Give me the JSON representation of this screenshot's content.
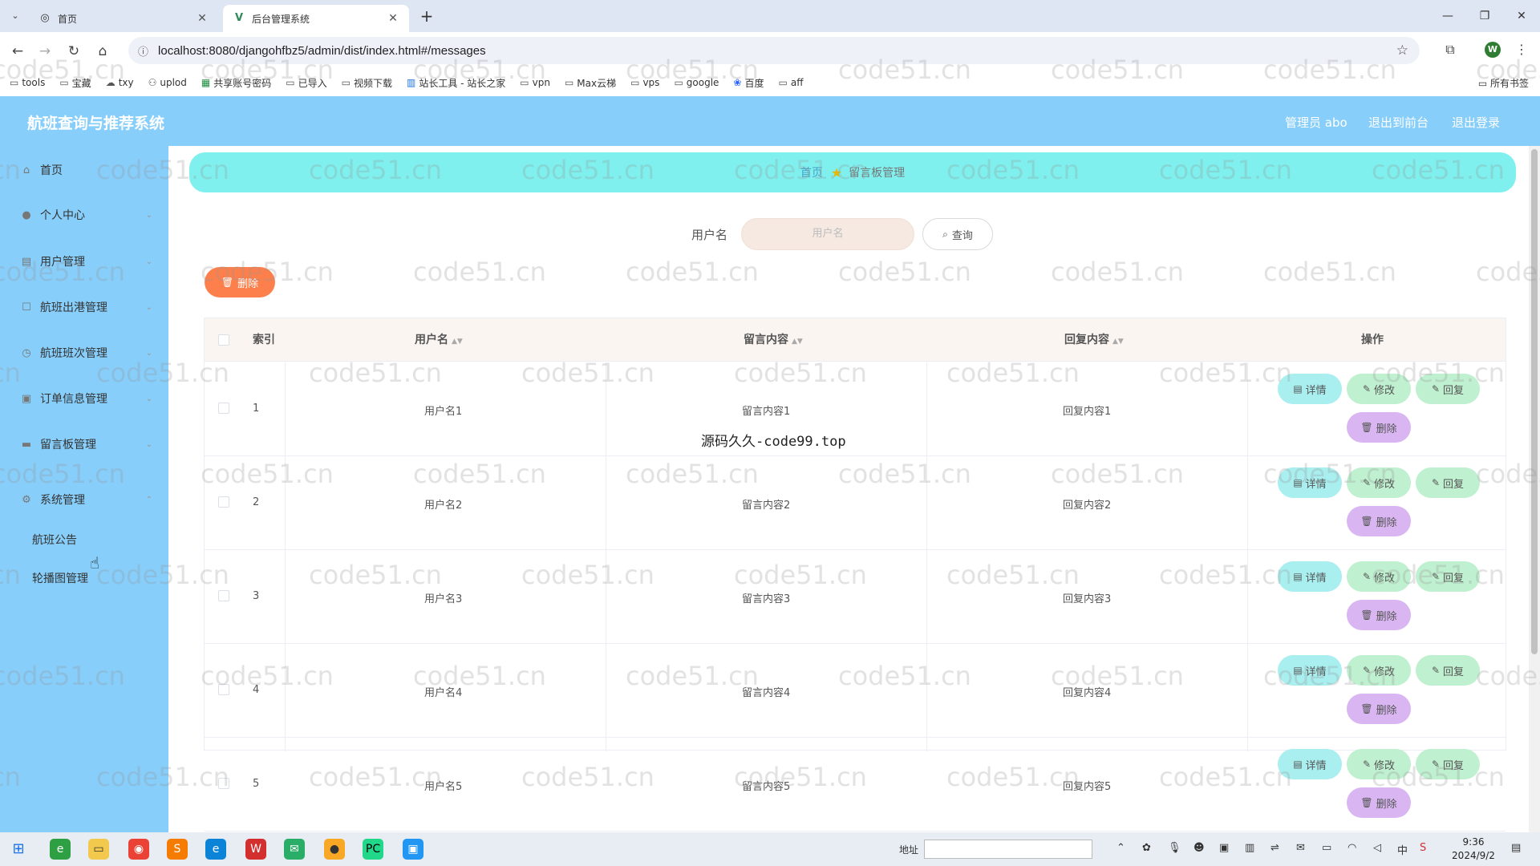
{
  "browser": {
    "tabs": [
      {
        "title": "首页",
        "active": false
      },
      {
        "title": "后台管理系统",
        "active": true
      }
    ],
    "url": "localhost:8080/djangohfbz5/admin/dist/index.html#/messages",
    "profile_initial": "W",
    "bookmarks": [
      "tools",
      "宝藏",
      "txy",
      "uplod",
      "共享账号密码",
      "已导入",
      "视频下载",
      "站长工具 - 站长之家",
      "vpn",
      "Max云梯",
      "vps",
      "google",
      "百度",
      "aff"
    ],
    "bookmarks_right": "所有书签"
  },
  "header": {
    "title": "航班查询与推荐系统",
    "user": "管理员 abo",
    "to_frontend": "退出到前台",
    "logout": "退出登录"
  },
  "sidebar": {
    "items": [
      {
        "label": "首页",
        "icon": "home-icon"
      },
      {
        "label": "个人中心",
        "icon": "user-icon"
      },
      {
        "label": "用户管理",
        "icon": "grid-icon"
      },
      {
        "label": "航班出港管理",
        "icon": "box-icon"
      },
      {
        "label": "航班班次管理",
        "icon": "clock-icon"
      },
      {
        "label": "订单信息管理",
        "icon": "doc-icon"
      },
      {
        "label": "留言板管理",
        "icon": "monitor-icon"
      },
      {
        "label": "系统管理",
        "icon": "gear-icon"
      }
    ],
    "submenu": [
      "航班公告",
      "轮播图管理"
    ]
  },
  "breadcrumb": {
    "home": "首页",
    "current": "留言板管理"
  },
  "search": {
    "label": "用户名",
    "placeholder": "用户名",
    "button": "查询"
  },
  "bulk_delete": "删除",
  "table": {
    "headers": {
      "index": "索引",
      "username": "用户名",
      "message": "留言内容",
      "reply": "回复内容",
      "actions": "操作"
    },
    "rows": [
      {
        "index": "1",
        "username": "用户名1",
        "message": "留言内容1",
        "reply": "回复内容1"
      },
      {
        "index": "2",
        "username": "用户名2",
        "message": "留言内容2",
        "reply": "回复内容2"
      },
      {
        "index": "3",
        "username": "用户名3",
        "message": "留言内容3",
        "reply": "回复内容3"
      },
      {
        "index": "4",
        "username": "用户名4",
        "message": "留言内容4",
        "reply": "回复内容4"
      },
      {
        "index": "5",
        "username": "用户名5",
        "message": "留言内容5",
        "reply": "回复内容5"
      }
    ],
    "actions": {
      "detail": "详情",
      "edit": "修改",
      "reply": "回复",
      "delete": "删除"
    }
  },
  "overlay_text": "源码久久-code99.top",
  "watermark": "code51.cn",
  "taskbar": {
    "address_label": "地址",
    "time": "9:36",
    "date": "2024/9/2",
    "ime": "中"
  },
  "colors": {
    "header": "#87cefa",
    "breadcrumb": "#7ff0ee",
    "bulk_delete": "#fd7f4b",
    "detail": "#a9eff0",
    "edit": "#bff0cf",
    "delete": "#d9b6f2"
  }
}
